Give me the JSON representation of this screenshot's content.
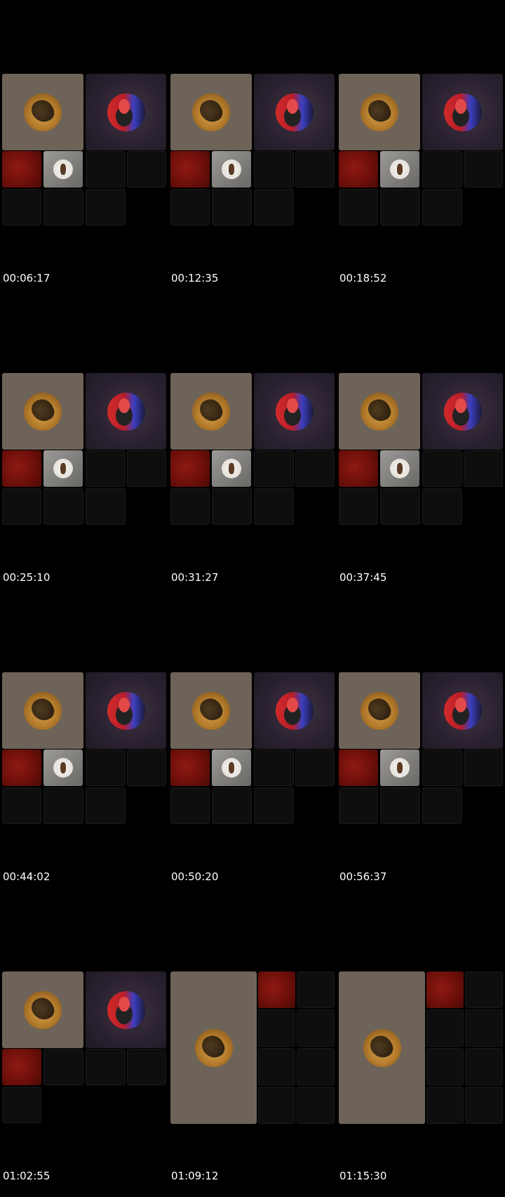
{
  "contact_sheet": {
    "frames": [
      {
        "timestamp": "00:06:17"
      },
      {
        "timestamp": "00:12:35"
      },
      {
        "timestamp": "00:18:52"
      },
      {
        "timestamp": "00:25:10"
      },
      {
        "timestamp": "00:31:27"
      },
      {
        "timestamp": "00:37:45"
      },
      {
        "timestamp": "00:44:02"
      },
      {
        "timestamp": "00:50:20"
      },
      {
        "timestamp": "00:56:37"
      },
      {
        "timestamp": "01:02:55"
      },
      {
        "timestamp": "01:09:12"
      },
      {
        "timestamp": "01:15:30"
      }
    ]
  }
}
